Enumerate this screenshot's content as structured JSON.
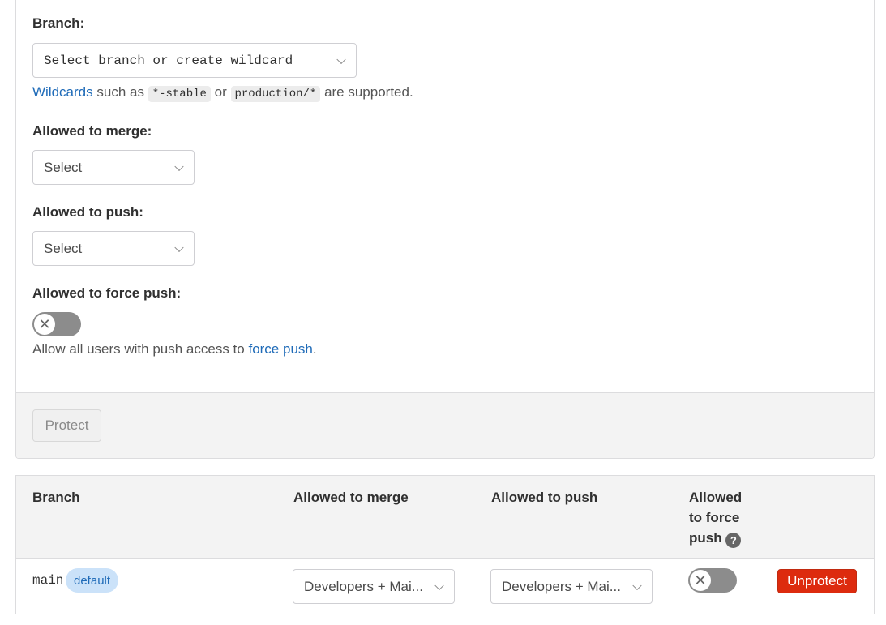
{
  "form": {
    "branch_label": "Branch:",
    "branch_select": {
      "placeholder": "Select branch or create wildcard"
    },
    "wildcard_help": {
      "link": "Wildcards",
      "text1": "such as",
      "example1": "*-stable",
      "text2": "or",
      "example2": "production/*",
      "text3": "are supported."
    },
    "merge_label": "Allowed to merge:",
    "merge_select": "Select",
    "push_label": "Allowed to push:",
    "push_select": "Select",
    "force_push_label": "Allowed to force push:",
    "force_push_toggle": {
      "state": "off",
      "icon": "close-icon"
    },
    "force_push_help": {
      "text": "Allow all users with push access to",
      "link": "force push",
      "suffix": "."
    },
    "protect_button": "Protect"
  },
  "table": {
    "headers": {
      "branch": "Branch",
      "merge": "Allowed to merge",
      "push": "Allowed to push",
      "force_push_line1": "Allowed",
      "force_push_line2": "to force",
      "force_push_line3": "push"
    },
    "rows": [
      {
        "branch": "main",
        "badge": "default",
        "merge": "Developers + Mai...",
        "push": "Developers + Mai...",
        "force_push": "off",
        "action": "Unprotect"
      }
    ]
  },
  "colors": {
    "link": "#1f6bb8",
    "danger": "#dd2b0e",
    "badge_bg": "#cbe2f9",
    "toggle_off": "#8c8c8c"
  }
}
